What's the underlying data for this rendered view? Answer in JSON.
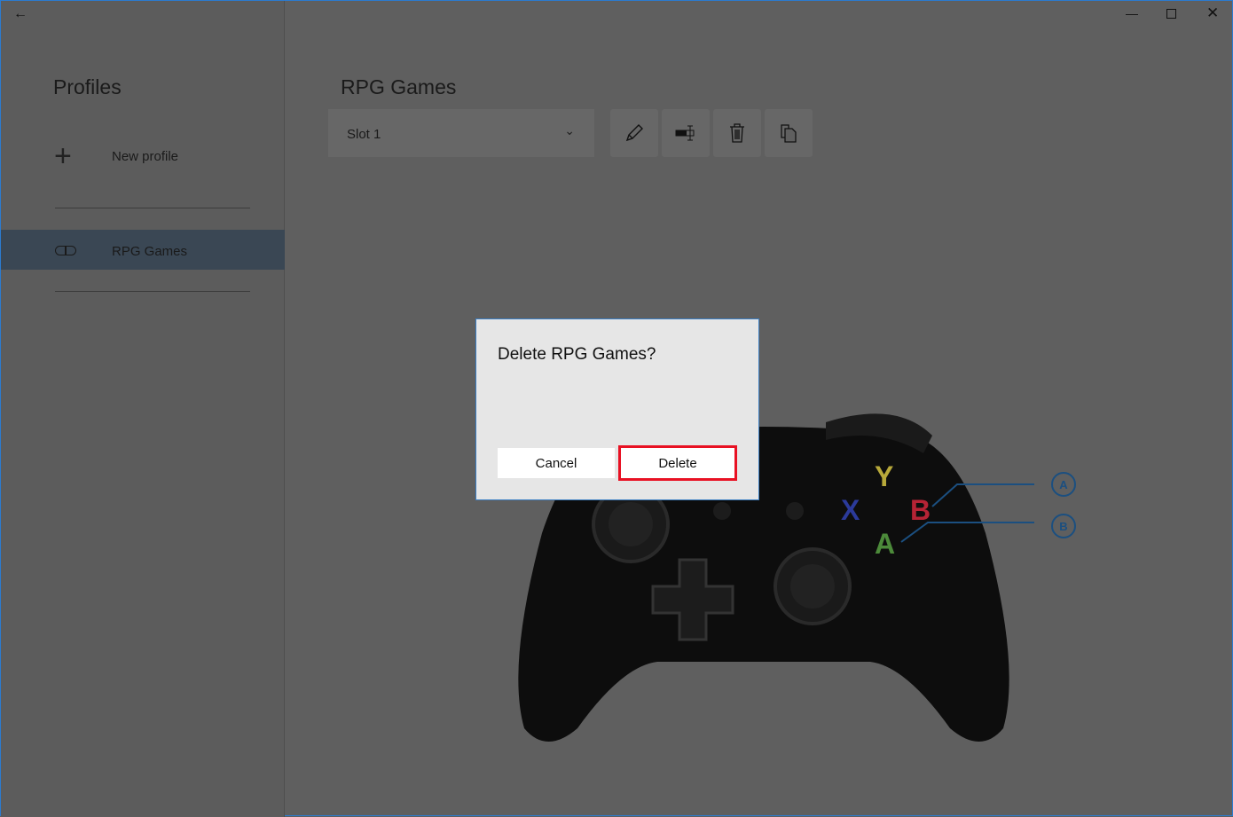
{
  "sidebar": {
    "title": "Profiles",
    "new_profile": "New profile",
    "profiles": [
      {
        "label": "RPG Games",
        "selected": true
      }
    ]
  },
  "main": {
    "title": "RPG Games",
    "slot": {
      "value": "Slot 1"
    },
    "toolbar": [
      "pencil-icon",
      "rename-icon",
      "trash-icon",
      "copy-icon"
    ]
  },
  "dialog": {
    "title": "Delete RPG Games?",
    "cancel": "Cancel",
    "delete": "Delete",
    "highlight_color": "#e81123"
  },
  "controller": {
    "buttons": [
      {
        "label": "Y",
        "color": "#b8a93a"
      },
      {
        "label": "X",
        "color": "#2b3a9a"
      },
      {
        "label": "B",
        "color": "#b52335"
      },
      {
        "label": "A",
        "color": "#4c8a3a"
      }
    ],
    "callouts": [
      "A",
      "B"
    ]
  }
}
